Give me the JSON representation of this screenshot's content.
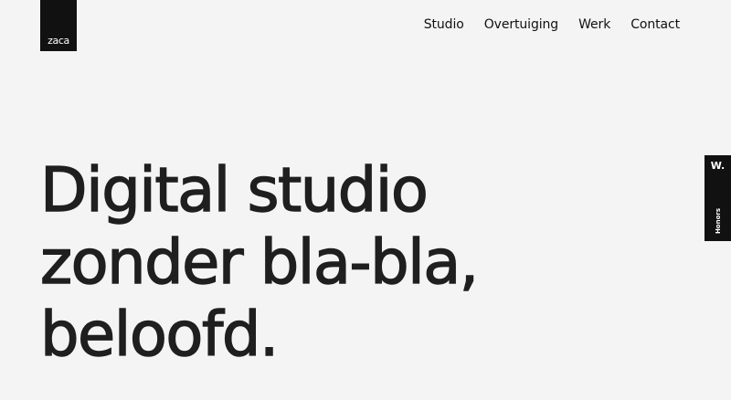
{
  "brand": {
    "logo_text": "zaca"
  },
  "nav": {
    "items": [
      {
        "label": "Studio"
      },
      {
        "label": "Overtuiging"
      },
      {
        "label": "Werk"
      },
      {
        "label": "Contact"
      }
    ]
  },
  "hero": {
    "lines": [
      "Digital studio",
      "zonder bla-bla,",
      "beloofd."
    ]
  },
  "honors_badge": {
    "mark": "W.",
    "label": "Honors"
  },
  "colors": {
    "background": "#f4f4f4",
    "text": "#1f1f1f",
    "brand_black": "#111111"
  }
}
